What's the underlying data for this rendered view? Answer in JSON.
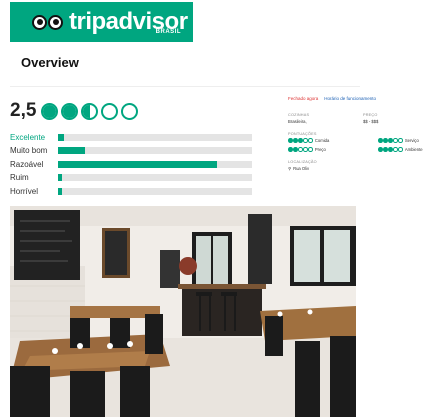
{
  "logo": {
    "brand": "tripadvisor",
    "sub": "BRASIL"
  },
  "section_title": "Overview",
  "rating": {
    "value_label": "2,5",
    "value": 2.5,
    "max": 5
  },
  "histogram": [
    {
      "label": "Excelente",
      "fraction": 0.03,
      "active": true
    },
    {
      "label": "Muito bom",
      "fraction": 0.14,
      "active": false
    },
    {
      "label": "Razoável",
      "fraction": 0.82,
      "active": false
    },
    {
      "label": "Ruim",
      "fraction": 0.02,
      "active": false
    },
    {
      "label": "Horrível",
      "fraction": 0.02,
      "active": false
    }
  ],
  "info": {
    "status": "Fechado agora",
    "hours_link": "Horário de funcionamento",
    "cuisine_h": "COZINHAS",
    "cuisine_v": "Brasileira,",
    "price_h": "PREÇO",
    "price_v": "$$ - $$$",
    "scores_h": "PONTUAÇÕES",
    "scores": [
      {
        "label": "Comida",
        "value": 3
      },
      {
        "label": "Serviço",
        "value": 3
      },
      {
        "label": "Preço",
        "value": 2
      },
      {
        "label": "Ambiente",
        "value": 3
      }
    ],
    "location_h": "LOCALIZAÇÃO",
    "location_v": "Rua Oliv"
  },
  "colors": {
    "brand": "#00a680"
  }
}
